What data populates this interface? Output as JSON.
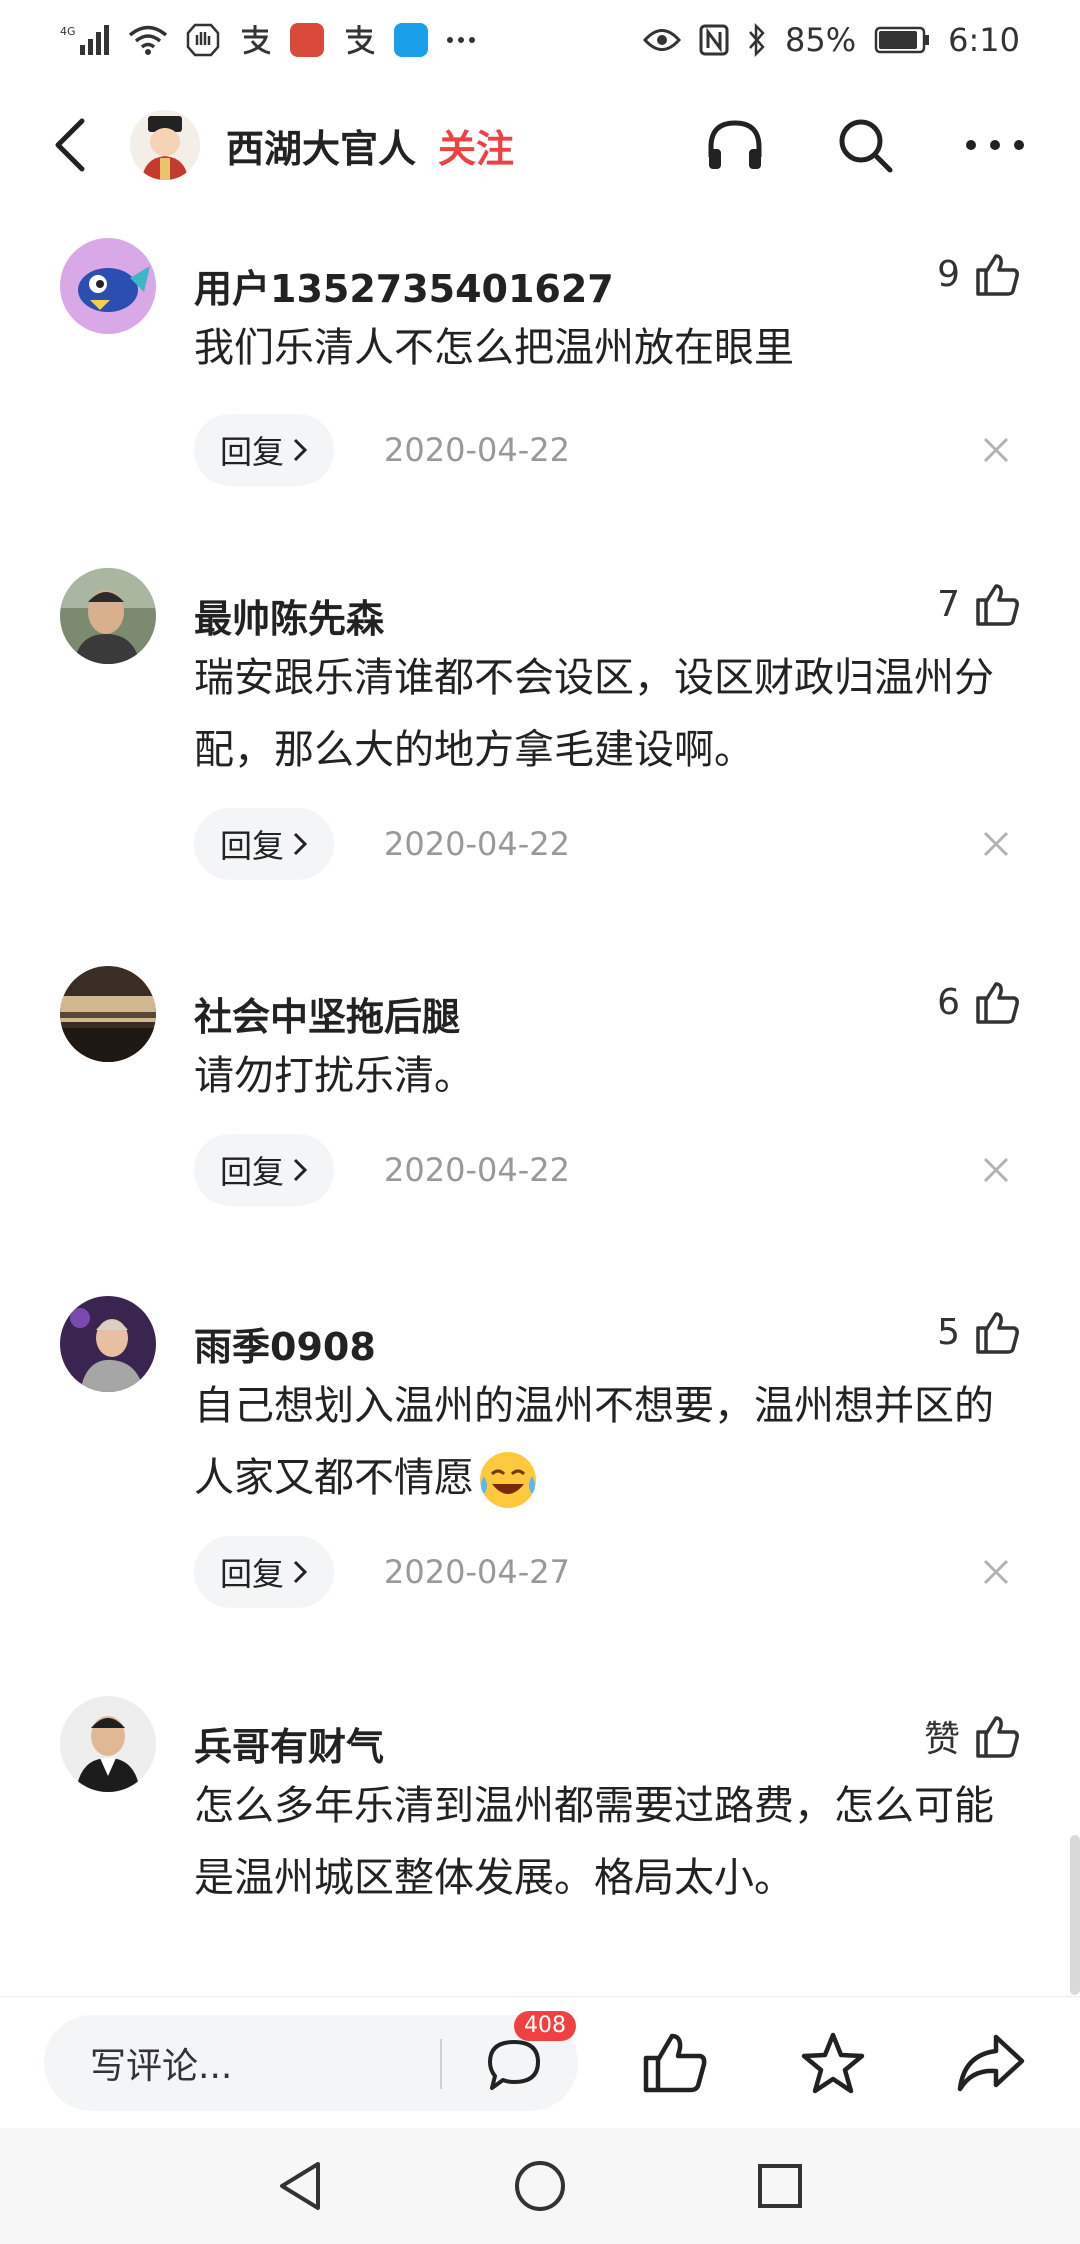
{
  "status_bar": {
    "network": "4G",
    "battery": "85%",
    "time": "6:10"
  },
  "header": {
    "author_name": "西湖大官人",
    "follow_label": "关注"
  },
  "comments": [
    {
      "name": "用户1352735401627",
      "likes": "9",
      "text": "我们乐清人不怎么把温州放在眼里",
      "reply_label": "回复",
      "date": "2020-04-22"
    },
    {
      "name": "最帅陈先森",
      "likes": "7",
      "text": "瑞安跟乐清谁都不会设区，设区财政归温州分配，那么大的地方拿毛建设啊。",
      "reply_label": "回复",
      "date": "2020-04-22"
    },
    {
      "name": "社会中坚拖后腿",
      "likes": "6",
      "text": "请勿打扰乐清。",
      "reply_label": "回复",
      "date": "2020-04-22"
    },
    {
      "name": "雨季0908",
      "likes": "5",
      "text": "自己想划入温州的温州不想要，温州想并区的人家又都不情愿",
      "reply_label": "回复",
      "date": "2020-04-27"
    },
    {
      "name": "兵哥有财气",
      "likes": "赞",
      "text": "怎么多年乐清到温州都需要过路费，怎么可能是温州城区整体发展。格局太小。"
    }
  ],
  "bottom_bar": {
    "input_placeholder": "写评论...",
    "comment_count": "408"
  },
  "colors": {
    "accent": "#f04142",
    "muted": "#999999",
    "pill_bg": "#f4f5f6"
  }
}
